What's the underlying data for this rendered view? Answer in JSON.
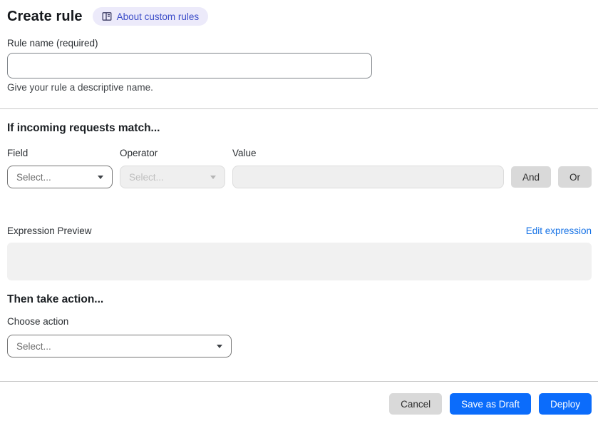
{
  "header": {
    "title": "Create rule",
    "about_label": "About custom rules"
  },
  "rule_name": {
    "label": "Rule name (required)",
    "value": "",
    "helper": "Give your rule a descriptive name."
  },
  "match": {
    "heading": "If incoming requests match...",
    "field": {
      "label": "Field",
      "value": "Select..."
    },
    "operator": {
      "label": "Operator",
      "value": "Select..."
    },
    "value": {
      "label": "Value",
      "value": ""
    },
    "and_label": "And",
    "or_label": "Or"
  },
  "expression": {
    "label": "Expression Preview",
    "edit_link": "Edit expression",
    "content": ""
  },
  "action": {
    "heading": "Then take action...",
    "choose_label": "Choose action",
    "select_value": "Select..."
  },
  "footer": {
    "cancel": "Cancel",
    "save_draft": "Save as Draft",
    "deploy": "Deploy"
  },
  "colors": {
    "primary_blue": "#0b6cfb",
    "link_blue": "#1773e6",
    "badge_bg": "#eceafa",
    "badge_text": "#3b4cc8",
    "gray_button": "#d9d9d9",
    "disabled_bg": "#efefef",
    "preview_bg": "#f1f1f1"
  },
  "icons": {
    "about_icon": "book-icon",
    "select_caret": "caret-down-icon"
  }
}
